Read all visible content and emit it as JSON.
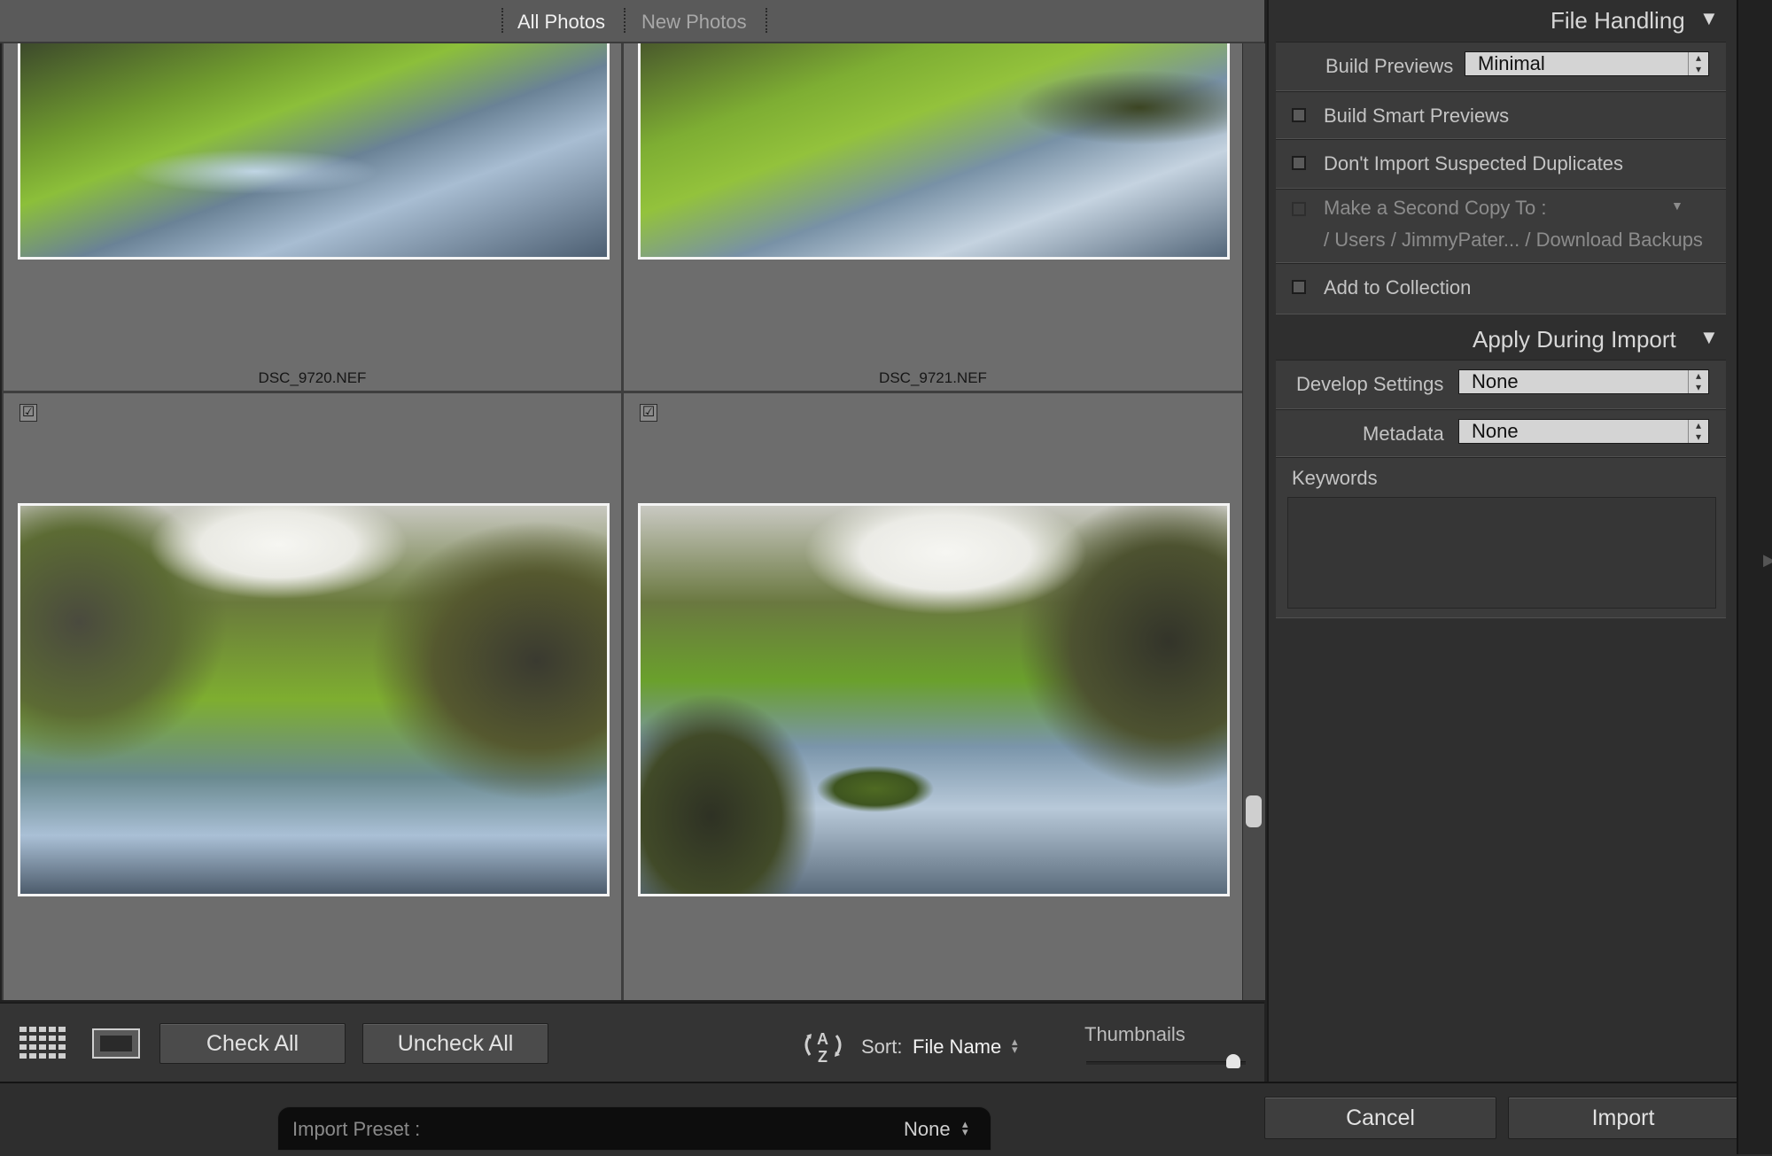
{
  "top_filter": {
    "tabs": [
      {
        "label": "All Photos",
        "active": true
      },
      {
        "label": "New Photos",
        "active": false
      }
    ]
  },
  "grid": {
    "photos": [
      {
        "filename": "DSC_9720.NEF",
        "checked": null
      },
      {
        "filename": "DSC_9721.NEF",
        "checked": null
      },
      {
        "filename": "",
        "checked": true
      },
      {
        "filename": "",
        "checked": true
      }
    ],
    "check_glyph": "☑"
  },
  "toolbar": {
    "grid_view_icon": "grid-view-icon",
    "loupe_view_icon": "loupe-view-icon",
    "check_all": "Check All",
    "uncheck_all": "Uncheck All",
    "sort_label": "Sort:",
    "sort_value": "File Name",
    "sort_icon": "sort-az-icon",
    "thumbnails_label": "Thumbnails",
    "thumbnail_size_fraction": 1.0
  },
  "bottom": {
    "preset_label": "Import Preset :",
    "preset_value": "None",
    "cancel": "Cancel",
    "import": "Import"
  },
  "file_handling": {
    "title": "File Handling",
    "build_previews_label": "Build Previews",
    "build_previews_value": "Minimal",
    "build_smart_previews": "Build Smart Previews",
    "dont_import_duplicates": "Don't Import Suspected Duplicates",
    "second_copy_label": "Make a Second Copy To :",
    "second_copy_path": "/ Users / JimmyPater... / Download Backups",
    "add_to_collection": "Add to Collection"
  },
  "apply_during_import": {
    "title": "Apply During Import",
    "develop_settings_label": "Develop Settings",
    "develop_settings_value": "None",
    "metadata_label": "Metadata",
    "metadata_value": "None",
    "keywords_label": "Keywords",
    "keywords_value": ""
  },
  "colors": {
    "panel_bg": "#2f2f2f",
    "grid_cell": "#6d6d6d",
    "thumb_border": "#f4f4f4"
  }
}
